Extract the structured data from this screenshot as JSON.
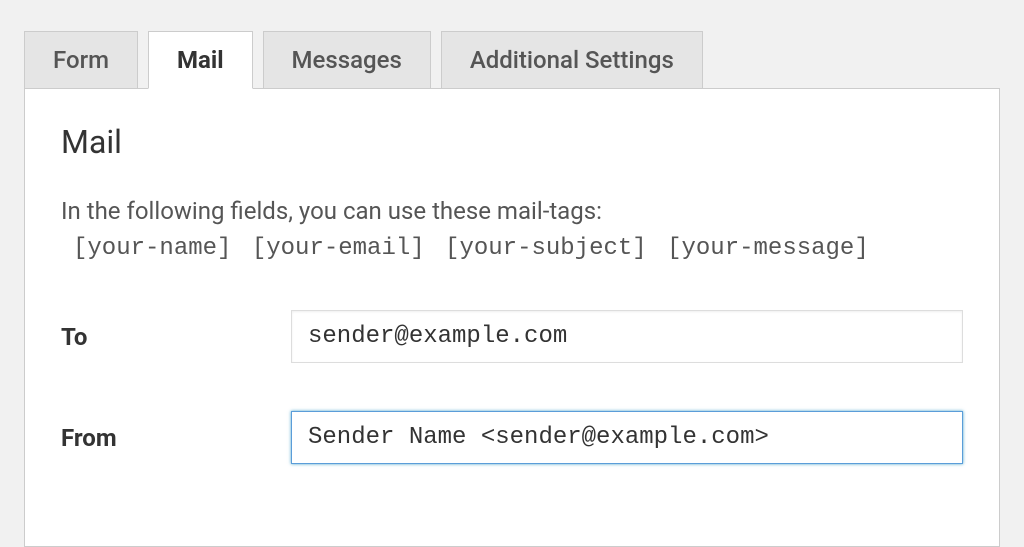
{
  "tabs": {
    "form": "Form",
    "mail": "Mail",
    "messages": "Messages",
    "additional": "Additional Settings"
  },
  "panel": {
    "title": "Mail",
    "instructions": "In the following fields, you can use these mail-tags:",
    "tags": "[your-name] [your-email] [your-subject] [your-message]"
  },
  "fields": {
    "to": {
      "label": "To",
      "value": "sender@example.com"
    },
    "from": {
      "label": "From",
      "value": "Sender Name <sender@example.com>"
    }
  }
}
